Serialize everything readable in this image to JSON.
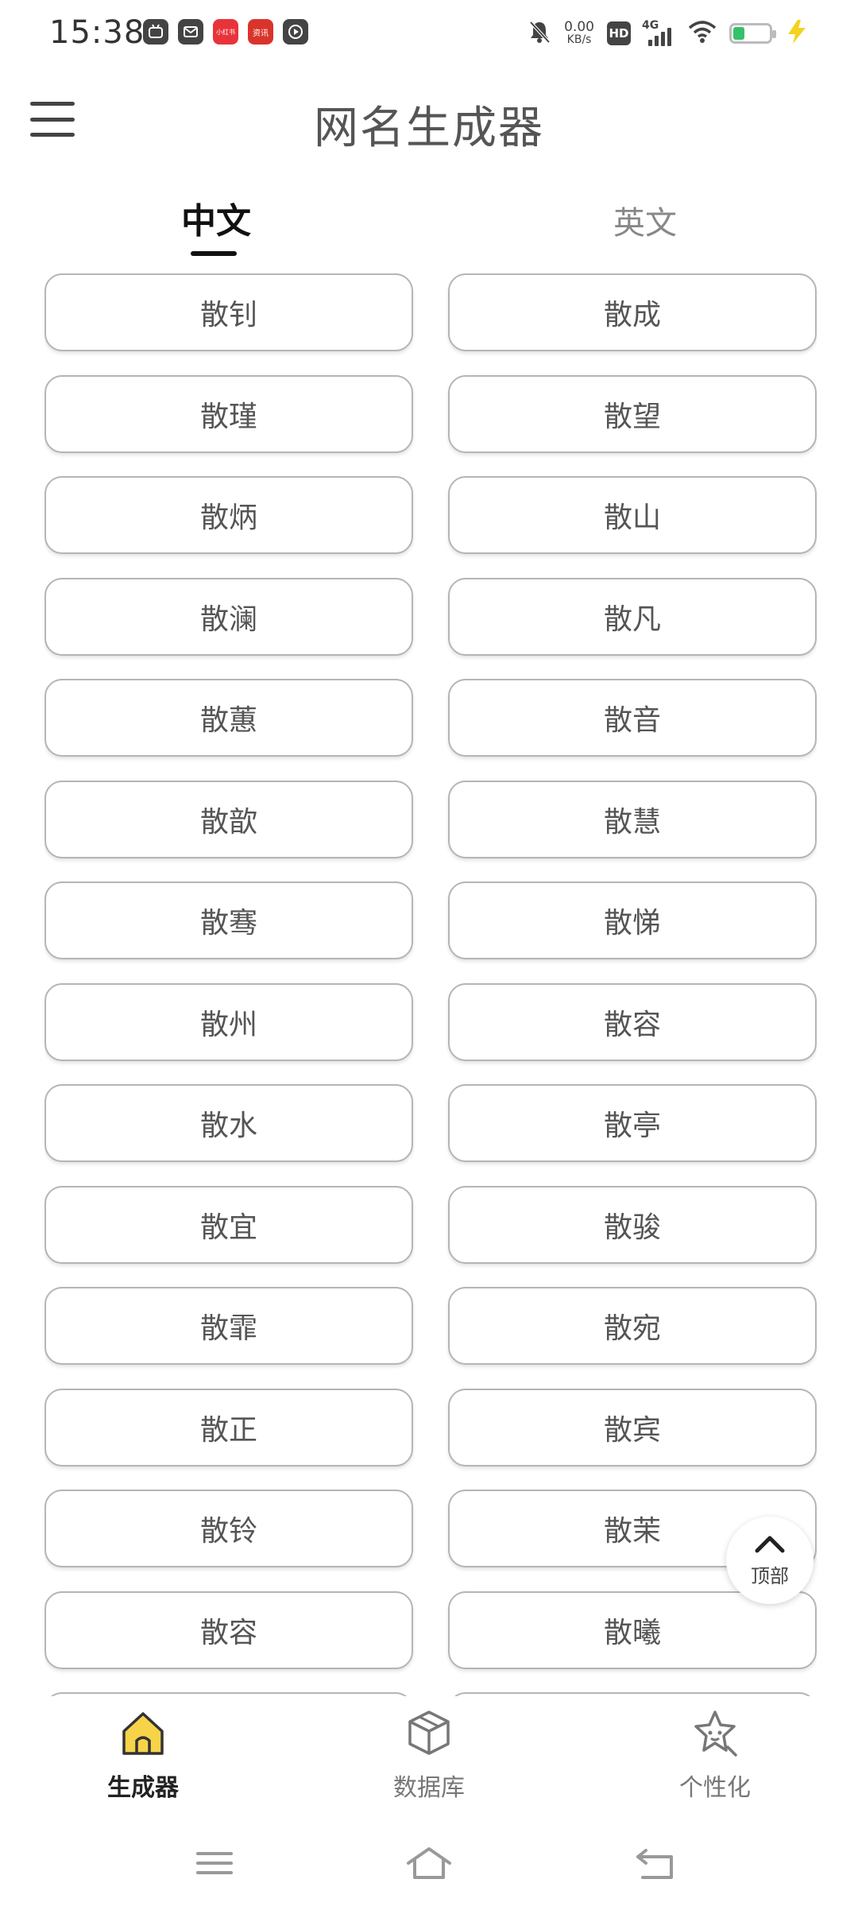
{
  "status_bar": {
    "time": "15:38",
    "net_speed_value": "0.00",
    "net_speed_unit": "KB/s",
    "hd": "HD",
    "network": "4G",
    "app_icons": [
      "bilibili-icon",
      "mail-icon",
      "xiaohongshu-icon",
      "news-icon",
      "video-icon"
    ],
    "small_app_text_1": "小红书",
    "small_app_text_2": "资讯"
  },
  "header": {
    "title": "网名生成器",
    "menu_icon": "hamburger-menu-icon"
  },
  "tabs": [
    {
      "label": "中文",
      "active": true
    },
    {
      "label": "英文",
      "active": false
    }
  ],
  "names": [
    [
      "散钊",
      "散成"
    ],
    [
      "散瑾",
      "散望"
    ],
    [
      "散炳",
      "散山"
    ],
    [
      "散澜",
      "散凡"
    ],
    [
      "散蕙",
      "散音"
    ],
    [
      "散歆",
      "散慧"
    ],
    [
      "散骞",
      "散悌"
    ],
    [
      "散州",
      "散容"
    ],
    [
      "散水",
      "散亭"
    ],
    [
      "散宜",
      "散骏"
    ],
    [
      "散霏",
      "散宛"
    ],
    [
      "散正",
      "散宾"
    ],
    [
      "散铃",
      "散茉"
    ],
    [
      "散容",
      "散曦"
    ],
    [
      "",
      ""
    ]
  ],
  "back_to_top": {
    "label": "顶部",
    "icon": "chevron-up-icon"
  },
  "bottom_nav": [
    {
      "label": "生成器",
      "icon": "home-icon",
      "active": true
    },
    {
      "label": "数据库",
      "icon": "cube-icon",
      "active": false
    },
    {
      "label": "个性化",
      "icon": "star-face-icon",
      "active": false
    }
  ],
  "colors": {
    "home_icon_fill": "#f7d34a",
    "accent": "#111111",
    "battery": "#37c06a",
    "charging": "#f4d21f"
  }
}
